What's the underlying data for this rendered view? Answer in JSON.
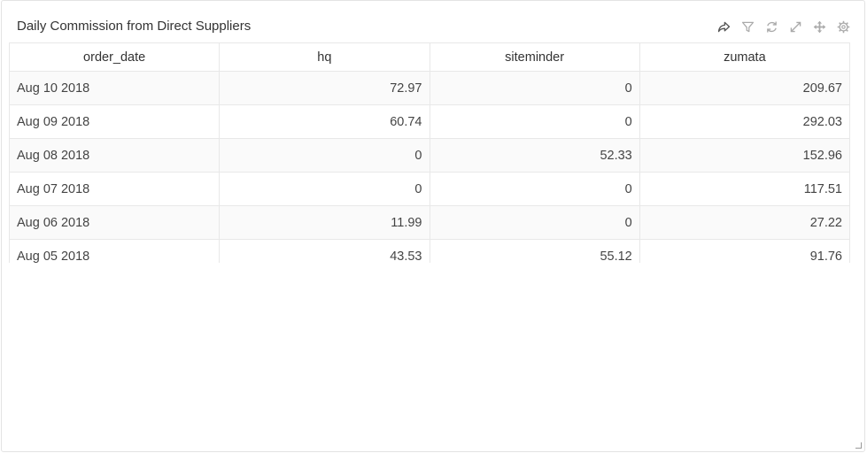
{
  "panel": {
    "title": "Daily Commission from Direct Suppliers",
    "toolbar": [
      {
        "name": "share-icon"
      },
      {
        "name": "filter-icon"
      },
      {
        "name": "refresh-icon"
      },
      {
        "name": "expand-icon"
      },
      {
        "name": "move-icon"
      },
      {
        "name": "settings-icon"
      }
    ]
  },
  "table": {
    "columns": [
      "order_date",
      "hq",
      "siteminder",
      "zumata"
    ],
    "rows": [
      [
        "Aug 10 2018",
        "72.97",
        "0",
        "209.67"
      ],
      [
        "Aug 09 2018",
        "60.74",
        "0",
        "292.03"
      ],
      [
        "Aug 08 2018",
        "0",
        "52.33",
        "152.96"
      ],
      [
        "Aug 07 2018",
        "0",
        "0",
        "117.51"
      ],
      [
        "Aug 06 2018",
        "11.99",
        "0",
        "27.22"
      ],
      [
        "Aug 05 2018",
        "43.53",
        "55.12",
        "91.76"
      ]
    ]
  },
  "colors": {
    "icon": "#aaaaaa",
    "icon_dark": "#555555",
    "border": "#e8e8e8",
    "stripe": "#fafafa"
  }
}
